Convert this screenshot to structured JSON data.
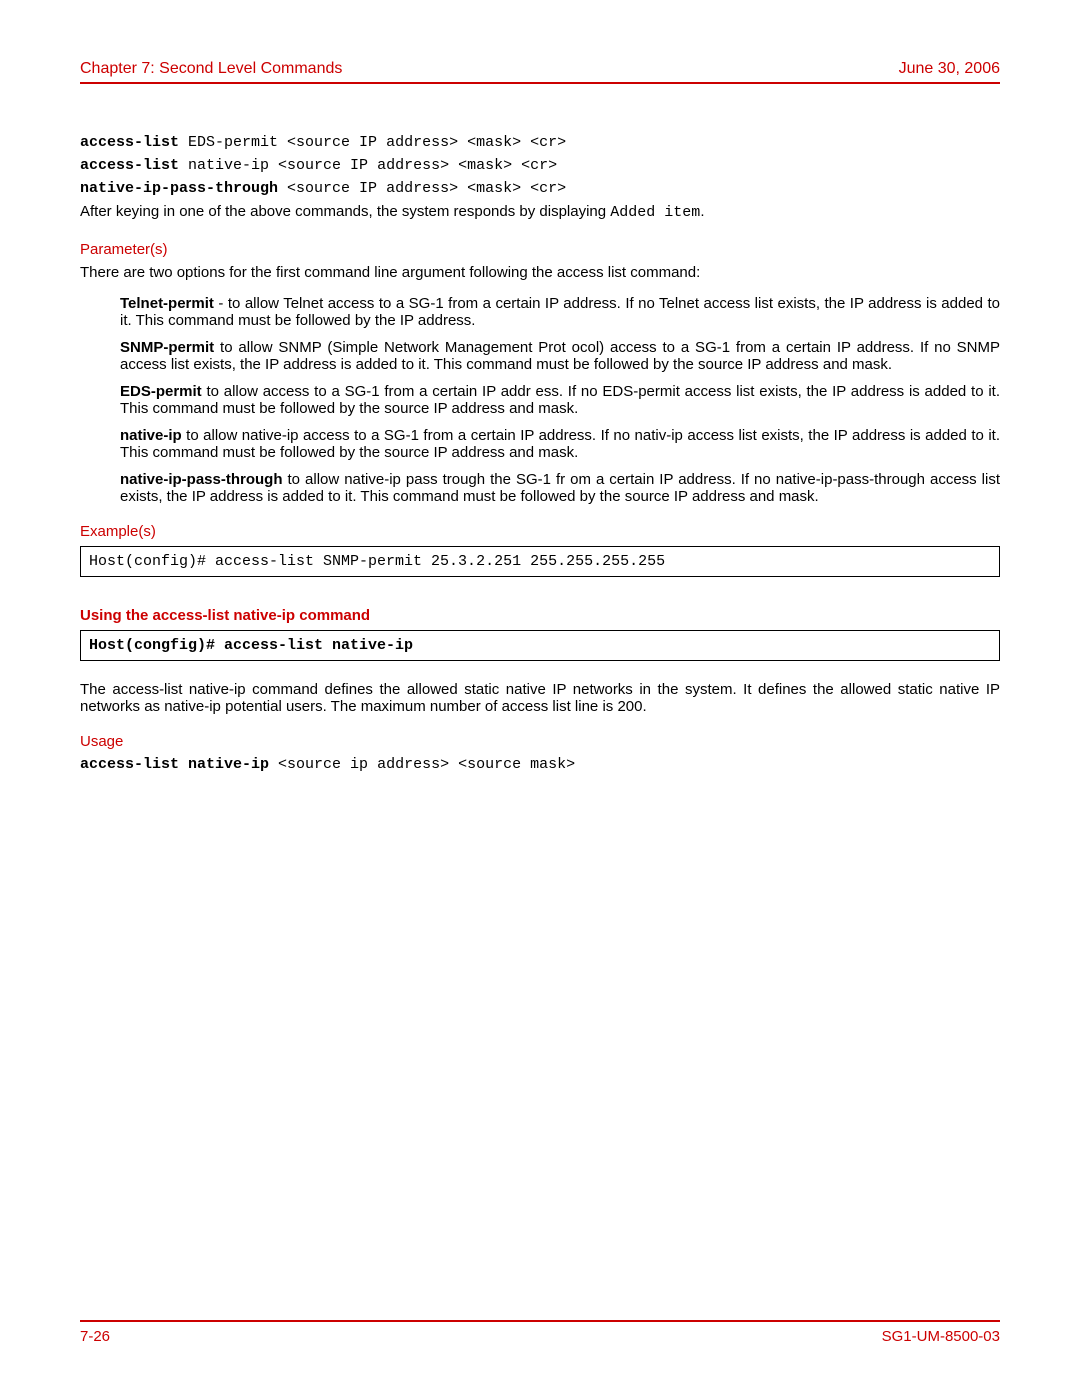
{
  "header": {
    "chapter": "Chapter 7: Second Level Commands",
    "date": "June 30, 2006"
  },
  "footer": {
    "page": "7-26",
    "docid": "SG1-UM-8500-03"
  },
  "cmd": {
    "l1_bold": "access-list",
    "l1_rest": " EDS-permit <source IP address> <mask> <cr>",
    "l2_bold": "access-list",
    "l2_rest": " native-ip <source IP address> <mask> <cr>",
    "l3_bold": "native-ip-pass-through",
    "l3_rest": " <source IP address> <mask> <cr>",
    "after_text_1": "After keying in one of the above commands, the system responds by displaying ",
    "after_code": "Added item",
    "after_text_2": "."
  },
  "params": {
    "title": "Parameter(s)",
    "intro": "There are two options for the first command line argument following the access list command:",
    "d1_term": "Telnet-permit",
    "d1_body": " - to allow Telnet access to a SG-1 from a certain IP address. If no Telnet access list exists, the IP address is added to it. This command must be followed by the IP address.",
    "d2_term": "SNMP-permit",
    "d2_body": " to allow SNMP (Simple Network Management Prot ocol) access to a SG-1 from a certain IP address. If no SNMP access list exists, the IP address is added to it. This command must be followed by the source IP address and mask.",
    "d3_term": "EDS-permit",
    "d3_body": " to allow access to a SG-1 from a certain IP addr ess. If no EDS-permit access list exists, the IP address is added to it. This command must be followed by the source IP address and mask.",
    "d4_term": "native-ip",
    "d4_body": " to allow native-ip access to a SG-1 from a certain  IP address. If no nativ-ip access list exists, the IP address is added to it. This command must be followed by the source IP address and mask.",
    "d5_term": "native-ip-pass-through",
    "d5_body": " to allow native-ip pass trough the SG-1 fr om a certain IP address. If no native-ip-pass-through access list exists, the IP address is added to it. This command must be followed by the source IP address and mask."
  },
  "examples": {
    "title": "Example(s)",
    "code": "Host(config)# access-list SNMP-permit 25.3.2.251 255.255.255.255"
  },
  "sub": {
    "heading": "Using the access-list native-ip command",
    "code": "Host(congfig)# access-list native-ip",
    "desc": "The access-list native-ip command defines the allowed static native IP networks in the system. It defines the allowed static native IP networks as native-ip potential users. The maximum number of access list line is 200."
  },
  "usage": {
    "title": "Usage",
    "bold": "access-list native-ip ",
    "rest": " <source ip address> <source mask>"
  }
}
